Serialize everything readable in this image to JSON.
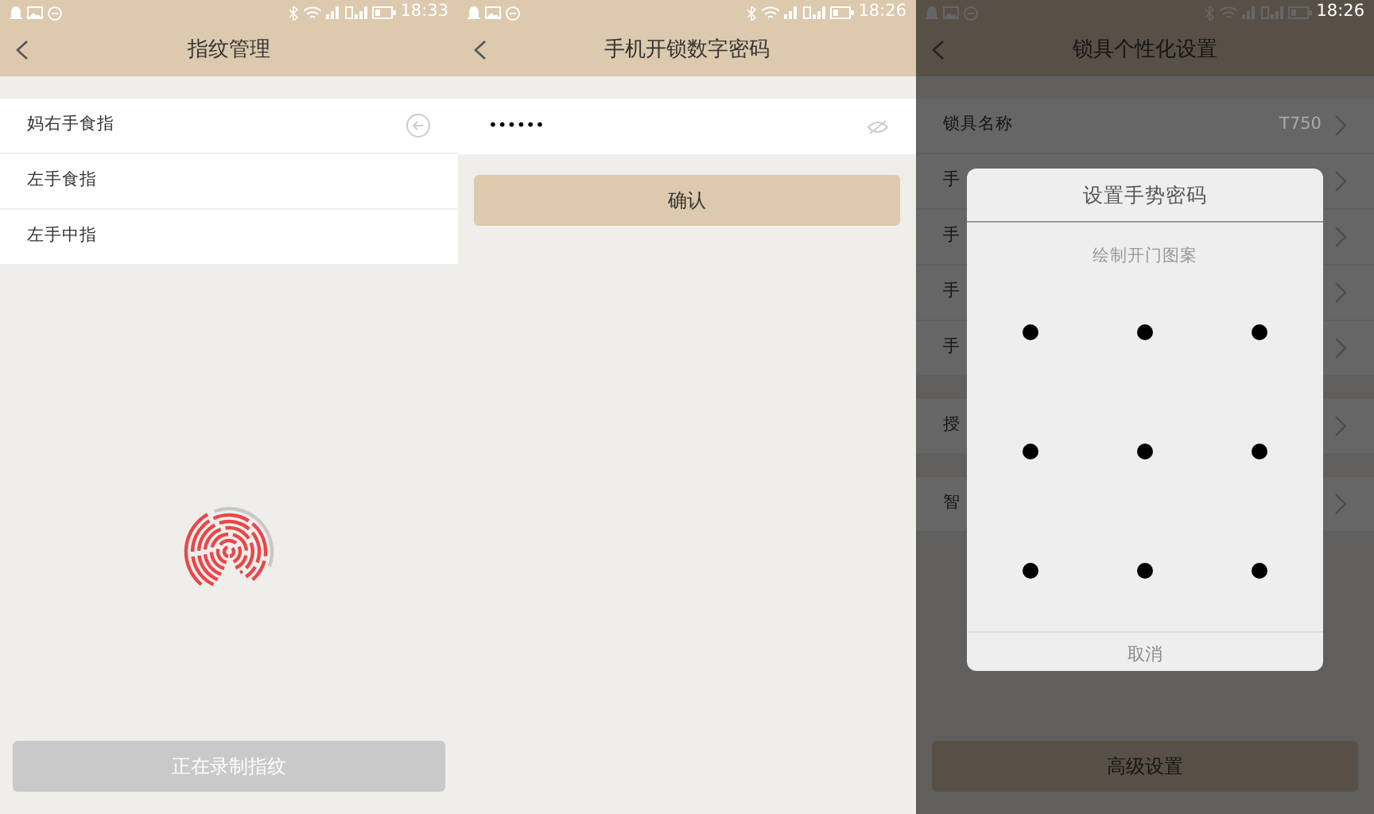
{
  "screens": [
    {
      "kind": "fingerprint",
      "status_bar": {
        "time": "18:33"
      },
      "title": "指纹管理",
      "fingers": [
        {
          "label": "妈右手食指",
          "show_action": true
        },
        {
          "label": "左手食指",
          "show_action": false
        },
        {
          "label": "左手中指",
          "show_action": false
        }
      ],
      "record_button": {
        "label": "正在录制指纹",
        "disabled": true
      }
    },
    {
      "kind": "pin",
      "status_bar": {
        "time": "18:26"
      },
      "title": "手机开锁数字密码",
      "password": {
        "value": "••••••"
      },
      "confirm_button": {
        "label": "确认"
      }
    },
    {
      "kind": "settings",
      "status_bar": {
        "time": "18:26"
      },
      "title": "锁具个性化设置",
      "groups": [
        [
          {
            "label": "锁具名称",
            "value": "T750"
          },
          {
            "label": "手"
          },
          {
            "label": "手"
          },
          {
            "label": "手"
          },
          {
            "label": "手"
          }
        ],
        [
          {
            "label": "授"
          }
        ],
        [
          {
            "label": "智"
          }
        ]
      ],
      "advanced_button": {
        "label": "高级设置"
      },
      "dialog": {
        "title": "设置手势密码",
        "hint": "绘制开门图案",
        "cancel": "取消"
      }
    }
  ]
}
